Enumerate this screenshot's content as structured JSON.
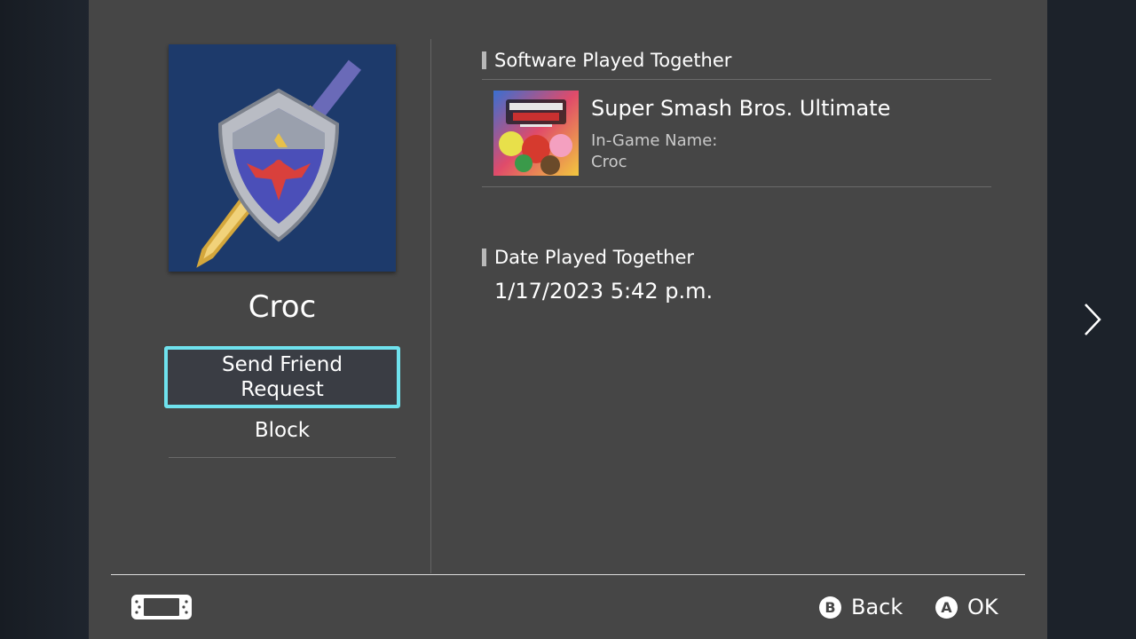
{
  "user": {
    "name": "Croc",
    "avatar_icon": "hylian-shield-icon"
  },
  "actions": {
    "send_friend_request": "Send Friend Request",
    "block": "Block"
  },
  "software_section": {
    "title": "Software Played Together",
    "game": {
      "title": "Super Smash Bros. Ultimate",
      "in_game_name_label": "In-Game Name:",
      "in_game_name": "Croc",
      "thumbnail_icon": "super-smash-bros-ultimate-cover-icon"
    }
  },
  "date_section": {
    "title": "Date Played Together",
    "value": "1/17/2023 5:42 p.m."
  },
  "footer": {
    "back_key": "B",
    "back_label": "Back",
    "ok_key": "A",
    "ok_label": "OK"
  },
  "colors": {
    "panel": "#464646",
    "focus_border": "#6fe2ee",
    "background": "#1b2028"
  }
}
